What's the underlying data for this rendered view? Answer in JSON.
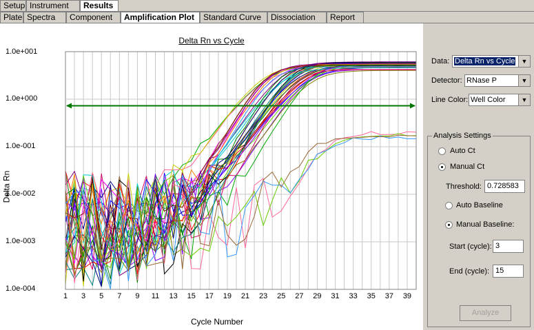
{
  "tabs_top": [
    {
      "label": "Setup",
      "active": false
    },
    {
      "label": "Instrument",
      "active": false
    },
    {
      "label": "Results",
      "active": true
    }
  ],
  "tabs_sub": [
    {
      "label": "Plate",
      "active": false
    },
    {
      "label": "Spectra",
      "active": false
    },
    {
      "label": "Component",
      "active": false
    },
    {
      "label": "Amplification Plot",
      "active": true
    },
    {
      "label": "Standard Curve",
      "active": false
    },
    {
      "label": "Dissociation",
      "active": false
    },
    {
      "label": "Report",
      "active": false
    }
  ],
  "controls": {
    "data_label": "Data:",
    "data_value": "Delta Rn vs Cycle",
    "detector_label": "Detector:",
    "detector_value": "RNase P",
    "linecolor_label": "Line Color:",
    "linecolor_value": "Well Color"
  },
  "analysis": {
    "title": "Analysis Settings",
    "auto_ct": "Auto Ct",
    "manual_ct": "Manual Ct",
    "threshold_label": "Threshold:",
    "threshold_value": "0.728583",
    "auto_baseline": "Auto Baseline",
    "manual_baseline": "Manual Baseline:",
    "start_label": "Start (cycle):",
    "start_value": "3",
    "end_label": "End (cycle):",
    "end_value": "15",
    "analyze_button": "Analyze",
    "ct_mode": "manual",
    "baseline_mode": "manual"
  },
  "chart_data": {
    "type": "line",
    "title": "Delta Rn vs Cycle",
    "xlabel": "Cycle Number",
    "ylabel": "Delta Rn",
    "yscale": "log",
    "ylim": [
      0.0001,
      10
    ],
    "xlim": [
      1,
      40
    ],
    "x_ticks": [
      "1",
      "3",
      "5",
      "7",
      "9",
      "11",
      "13",
      "15",
      "17",
      "19",
      "21",
      "23",
      "25",
      "27",
      "29",
      "31",
      "33",
      "35",
      "37",
      "39"
    ],
    "y_ticks": [
      "1.0e+001",
      "1.0e+000",
      "1.0e-001",
      "1.0e-002",
      "1.0e-003",
      "1.0e-004"
    ],
    "threshold": 0.728583,
    "threshold_color": "#007700",
    "grid": true,
    "series_note_count": 40,
    "curve_groups": [
      {
        "count": 34,
        "ct_range": [
          20.5,
          26.5
        ],
        "plateau_range": [
          4.0,
          6.2
        ]
      },
      {
        "count": 4,
        "ct_range": [
          26,
          28
        ],
        "plateau_range": [
          0.14,
          0.2
        ]
      }
    ],
    "series_colors": [
      "#ff0000",
      "#00aa00",
      "#0000ff",
      "#ff00ff",
      "#00cccc",
      "#cccc00",
      "#8000ff",
      "#ff8000",
      "#008080",
      "#800000",
      "#008000",
      "#000080",
      "#808000",
      "#800080",
      "#ff6699",
      "#66cc00",
      "#3399ff",
      "#996633",
      "#000000",
      "#cc0066"
    ]
  }
}
